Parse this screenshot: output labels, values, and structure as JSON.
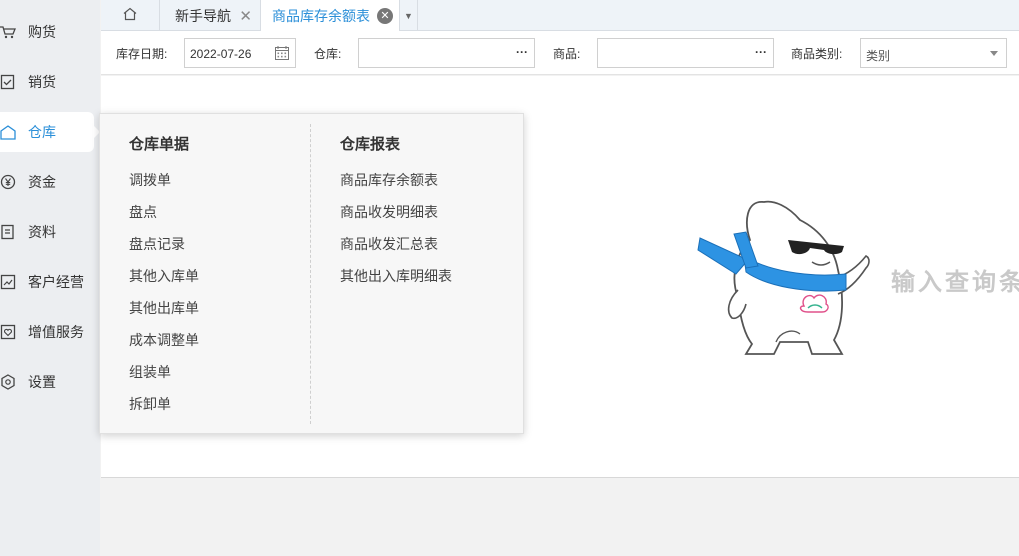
{
  "sidebar": {
    "items": [
      {
        "label": "购货",
        "icon": "cart-icon"
      },
      {
        "label": "销货",
        "icon": "sales-icon"
      },
      {
        "label": "仓库",
        "icon": "warehouse-icon"
      },
      {
        "label": "资金",
        "icon": "yen-icon"
      },
      {
        "label": "资料",
        "icon": "document-icon"
      },
      {
        "label": "客户经营",
        "icon": "chart-icon"
      },
      {
        "label": "增值服务",
        "icon": "heart-icon"
      },
      {
        "label": "设置",
        "icon": "gear-icon"
      }
    ],
    "active_index": 2,
    "active_color": "#2b8fd8"
  },
  "tabs": {
    "home_icon": "home-icon",
    "guide_label": "新手导航",
    "guide_close": "✕",
    "stock_label": "商品库存余额表",
    "stock_close": "✕",
    "more_icon": "▼"
  },
  "filter": {
    "date_label": "库存日期:",
    "date_value": "2022-07-26",
    "warehouse_label": "仓库:",
    "warehouse_dots": "···",
    "product_label": "商品:",
    "product_dots": "···",
    "category_label": "商品类别:",
    "category_value": "类别"
  },
  "menu": {
    "left_title": "仓库单据",
    "left_items": [
      "调拨单",
      "盘点",
      "盘点记录",
      "其他入库单",
      "其他出库单",
      "成本调整单",
      "组装单",
      "拆卸单"
    ],
    "right_title": "仓库报表",
    "right_items": [
      "商品库存余额表",
      "商品收发明细表",
      "商品收发汇总表",
      "其他出入库明细表"
    ]
  },
  "content": {
    "watermark_text": "输入查询条"
  }
}
